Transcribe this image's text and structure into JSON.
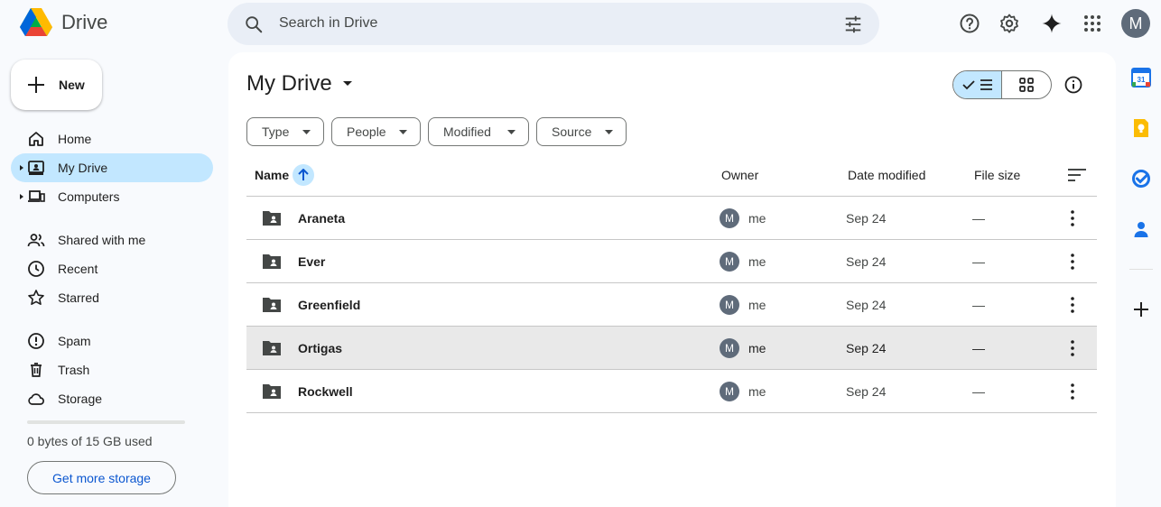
{
  "app": {
    "name": "Drive",
    "user_initial": "M"
  },
  "search": {
    "placeholder": "Search in Drive"
  },
  "header_icons": [
    "help-icon",
    "settings-icon",
    "gemini-sparkle-icon",
    "apps-grid-icon"
  ],
  "new_button": {
    "label": "New"
  },
  "sidebar": {
    "items": [
      {
        "label": "Home",
        "icon": "home-icon"
      },
      {
        "label": "My Drive",
        "icon": "my-drive-icon",
        "active": true
      },
      {
        "label": "Computers",
        "icon": "computers-icon"
      },
      {
        "label": "Shared with me",
        "icon": "shared-icon"
      },
      {
        "label": "Recent",
        "icon": "clock-icon"
      },
      {
        "label": "Starred",
        "icon": "star-icon"
      },
      {
        "label": "Spam",
        "icon": "spam-icon"
      },
      {
        "label": "Trash",
        "icon": "trash-icon"
      },
      {
        "label": "Storage",
        "icon": "cloud-icon"
      }
    ],
    "storage_used_fraction": 0,
    "storage_text": "0 bytes of 15 GB used",
    "get_storage_label": "Get more storage"
  },
  "main": {
    "title": "My Drive",
    "filters": [
      "Type",
      "People",
      "Modified",
      "Source"
    ],
    "columns": {
      "name": "Name",
      "owner": "Owner",
      "date": "Date modified",
      "size": "File size"
    },
    "rows": [
      {
        "name": "Araneta",
        "owner_initial": "M",
        "owner": "me",
        "date": "Sep 24",
        "size": "—"
      },
      {
        "name": "Ever",
        "owner_initial": "M",
        "owner": "me",
        "date": "Sep 24",
        "size": "—"
      },
      {
        "name": "Greenfield",
        "owner_initial": "M",
        "owner": "me",
        "date": "Sep 24",
        "size": "—"
      },
      {
        "name": "Ortigas",
        "owner_initial": "M",
        "owner": "me",
        "date": "Sep 24",
        "size": "—",
        "hovered": true
      },
      {
        "name": "Rockwell",
        "owner_initial": "M",
        "owner": "me",
        "date": "Sep 24",
        "size": "—"
      }
    ]
  },
  "side_rail": [
    "calendar-icon",
    "keep-icon",
    "tasks-icon",
    "contacts-icon",
    "add-icon"
  ],
  "colors": {
    "accent": "#0b57d0",
    "selected_bg": "#c2e7ff",
    "search_bg": "#e9eef6",
    "page_bg": "#f8fafd"
  }
}
